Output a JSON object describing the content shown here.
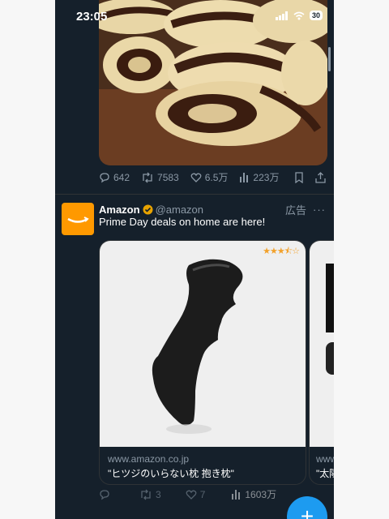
{
  "status": {
    "time": "23:05",
    "battery": "30"
  },
  "post1": {
    "replies": "642",
    "retweets": "7583",
    "likes": "6.5万",
    "views": "223万"
  },
  "ad": {
    "name": "Amazon",
    "handle": "@amazon",
    "label": "広告",
    "more": "···",
    "text": "Prime Day deals on home are here!",
    "cards": [
      {
        "domain": "www.amazon.co.jp",
        "title": "\"ヒツジのいらない枕 抱き枕\"",
        "stars": "★★★⯪☆"
      },
      {
        "domain": "www.amazon.co.jp",
        "title": "\"太陽"
      }
    ],
    "retweets": "3",
    "likes": "7",
    "views": "1603万"
  },
  "fab": {
    "label": "+"
  },
  "colors": {
    "background": "#15202b",
    "accent": "#1d9bf0",
    "amazon": "#ff9900",
    "muted": "#8b98a5"
  }
}
